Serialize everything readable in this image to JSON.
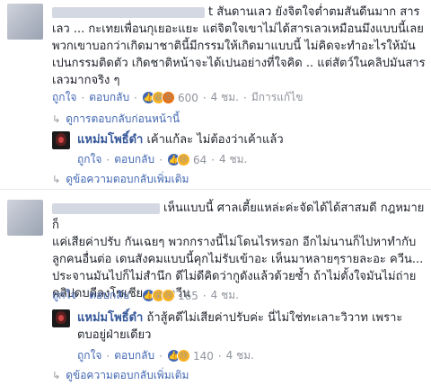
{
  "comment1": {
    "text_line1": "t สันดานเลว ยังจิตใจต่ำตมสันดีนมาก สาร",
    "text_line2": "เลว ... กะเทยเพื่อนกุเยอะแยะ แต่จิตใจเขาไม่ได้สารเลวเหมือนมึงแบบนี้เลย",
    "text_line3": "พวกเขาบอกว่าเกิดมาชาตินี้มีกรรมให้เกิดมาแบบนี้ ไม่คิดจะทำอะไรให้มัน",
    "text_line4": "เปนกรรมติดตัว เกิดชาติหน้าจะได้เปนอย่างที่ใจคิด .. แต่สัตว์ในคลิปมันสาร",
    "text_line5": "เลวมากจริง ๆ",
    "like": "ถูกใจ",
    "reply": "ตอบกลับ",
    "count": "600",
    "time": "4 ชม.",
    "edited": "มีการแก้ไข",
    "prev_replies": "ดูการตอบกลับก่อนหน้านี้"
  },
  "reply1": {
    "author": "แหม่มโพธิ์ดำ",
    "text": "เค้าแก้ละ ไม่ต้องว่าเค้าแล้ว",
    "like": "ถูกใจ",
    "reply": "ตอบกลับ",
    "count": "64",
    "time": "4 ชม.",
    "more": "ดูข้อความตอบกลับเพิ่มเติม"
  },
  "comment2": {
    "text_line1": "เห็นแบบนี้ ศาลเตี้ยแหล่ะค่ะจัดได้ได้สาสมดี กฎหมายก็",
    "text_line2": "แค่เสียค่าปรับ กันเฉยๆ พวกกรางนี้ไม่โดนไรหรอก อีกไม่นานก็ไปหาทำกับ",
    "text_line3": "ลูกคนอื่นต่อ เดนสังคมแบบนี้คุกไม่รับเข้าอะ เห็นมาหลายๆรายละอะ ควีน...",
    "text_line4": "ประจานมันไปก็ไม่สำนึก ดีไม่ดีคิดว่ากูดังแล้วด้วยซ้ำ ถ้าไม่ตั้งใจมันไม่ถ่าย",
    "text_line5": "คลิปดบดีลงโซเชียลนะ ควีน",
    "like": "ถูกใจ",
    "reply": "ตอบกลับ",
    "count": "165",
    "time": "4 ชม."
  },
  "reply2": {
    "author": "แหม่มโพธิ์ดำ",
    "text_line1": "ถ้าสู้คดีไม่เสียค่าปรับค่ะ นี่ไม่ใช่ทะเลาะวิวาท เพราะ",
    "text_line2": "ตบอยู่ฝ่ายเดียว",
    "like": "ถูกใจ",
    "reply": "ตอบกลับ",
    "count": "140",
    "time": "4 ชม.",
    "more": "ดูข้อความตอบกลับเพิ่มเติม"
  },
  "colors": {
    "link": "#4267b2",
    "name": "#365899",
    "meta": "#90949c",
    "text": "#1d2129"
  }
}
